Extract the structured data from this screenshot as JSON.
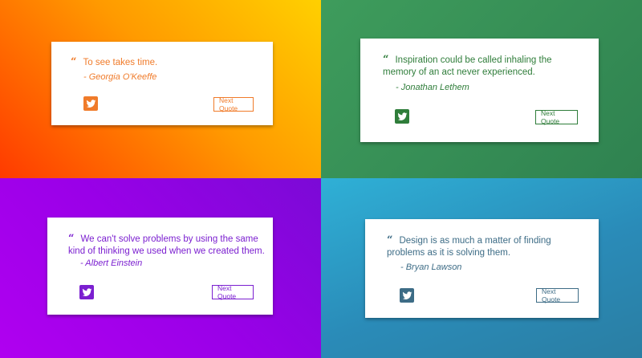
{
  "colors": {
    "orange": "#f07b2a",
    "green": "#2f7d3a",
    "purple": "#7b1fd0",
    "blue": "#3d6c86"
  },
  "button_label": "Next Quote",
  "share_icon": "twitter-icon",
  "cards": [
    {
      "quote": "To see takes time.",
      "author": "- Georgia O'Keeffe"
    },
    {
      "quote": "Inspiration could be called inhaling the memory of an act never experienced.",
      "author": "- Jonathan Lethem"
    },
    {
      "quote": "We can't solve problems by using the same kind of thinking we used when we created them.",
      "author": "- Albert Einstein"
    },
    {
      "quote": "Design is as much a matter of finding problems as it is solving them.",
      "author": "- Bryan Lawson"
    }
  ]
}
